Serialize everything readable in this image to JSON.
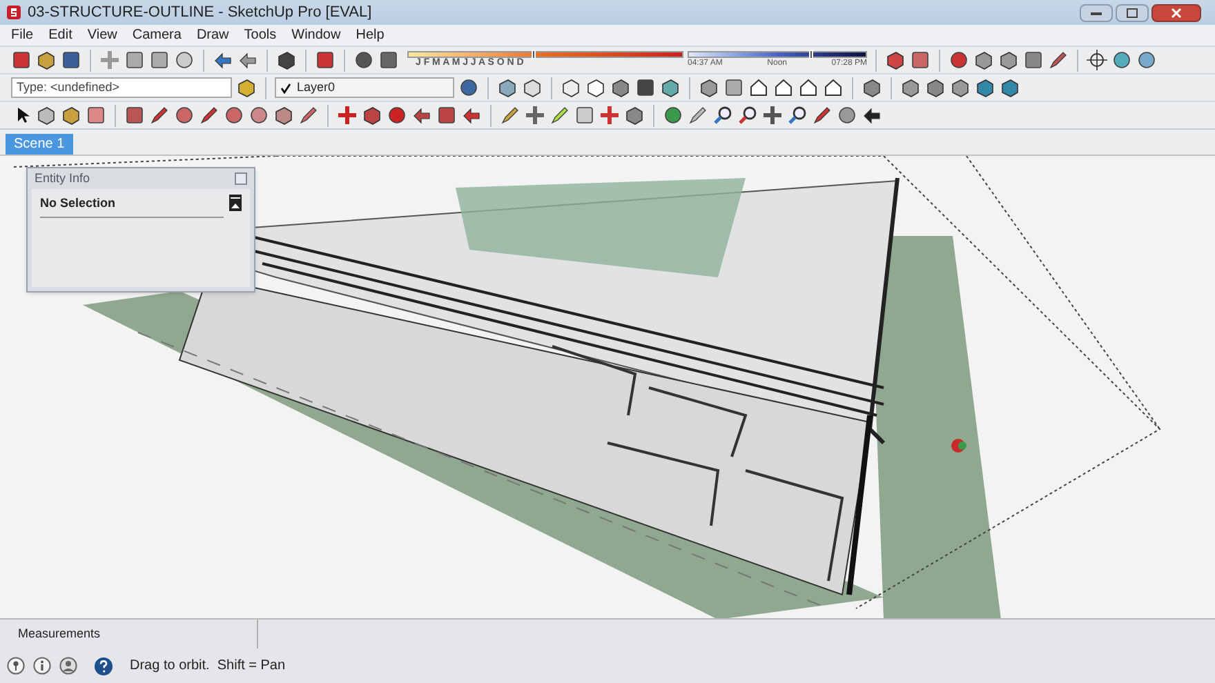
{
  "window": {
    "title": "03-STRUCTURE-OUTLINE - SketchUp Pro [EVAL]"
  },
  "menu": [
    "File",
    "Edit",
    "View",
    "Camera",
    "Draw",
    "Tools",
    "Window",
    "Help"
  ],
  "shadows": {
    "months": "J F M A M J J A S O N D",
    "month_slider": {
      "level": 0.45
    },
    "times": [
      "04:37 AM",
      "Noon",
      "07:28 PM"
    ],
    "time_slider": {
      "level": 0.68
    }
  },
  "type_field": {
    "value": "Type: <undefined>"
  },
  "layer_field": {
    "value": "Layer0",
    "checked": true
  },
  "scene_tabs": [
    {
      "label": "Scene 1",
      "selected": true
    }
  ],
  "entity_info": {
    "title": "Entity Info",
    "selection": "No Selection"
  },
  "measurements": {
    "label": "Measurements"
  },
  "status_bar": {
    "text": "Drag to orbit.  Shift = Pan"
  }
}
